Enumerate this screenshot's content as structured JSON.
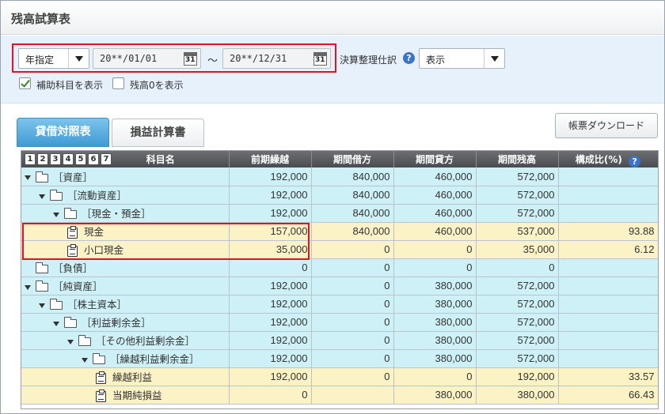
{
  "page": {
    "title": "残高試算表"
  },
  "filter": {
    "period_type": "年指定",
    "date_from": "20**/01/01",
    "date_to": "20**/12/31",
    "range_separator": "〜",
    "calendar_day": "31",
    "closing_entries_label": "決算整理仕訳",
    "closing_entries_value": "表示",
    "show_sub_accounts_label": "補助科目を表示",
    "show_sub_accounts_checked": true,
    "show_zero_balance_label": "残高0を表示",
    "show_zero_balance_checked": false
  },
  "tabs": [
    {
      "label": "貸借対照表",
      "active": true
    },
    {
      "label": "損益計算書",
      "active": false
    }
  ],
  "download_button": "帳票ダウンロード",
  "table": {
    "level_buttons": [
      "1",
      "2",
      "3",
      "4",
      "5",
      "6",
      "7"
    ],
    "columns": [
      "科目名",
      "前期繰越",
      "期間借方",
      "期間貸方",
      "期間残高",
      "構成比(%)"
    ],
    "rows": [
      {
        "name": "［資産］",
        "level": 0,
        "type": "folder",
        "expand": true,
        "color": "blue",
        "values": [
          "192,000",
          "840,000",
          "460,000",
          "572,000",
          ""
        ]
      },
      {
        "name": "［流動資産］",
        "level": 1,
        "type": "folder",
        "expand": true,
        "color": "blue",
        "values": [
          "192,000",
          "840,000",
          "460,000",
          "572,000",
          ""
        ]
      },
      {
        "name": "［現金・預金］",
        "level": 2,
        "type": "folder",
        "expand": true,
        "color": "blue",
        "values": [
          "192,000",
          "840,000",
          "460,000",
          "572,000",
          ""
        ]
      },
      {
        "name": "現金",
        "level": 3,
        "type": "account",
        "expand": false,
        "color": "yellow",
        "values": [
          "157,000",
          "840,000",
          "460,000",
          "537,000",
          "93.88"
        ]
      },
      {
        "name": "小口現金",
        "level": 3,
        "type": "account",
        "expand": false,
        "color": "yellow",
        "values": [
          "35,000",
          "0",
          "0",
          "35,000",
          "6.12"
        ]
      },
      {
        "name": "［負債］",
        "level": 0,
        "type": "folder",
        "expand": false,
        "color": "blue",
        "values": [
          "0",
          "0",
          "0",
          "0",
          ""
        ]
      },
      {
        "name": "［純資産］",
        "level": 0,
        "type": "folder",
        "expand": true,
        "color": "blue",
        "values": [
          "192,000",
          "0",
          "380,000",
          "572,000",
          ""
        ]
      },
      {
        "name": "［株主資本］",
        "level": 1,
        "type": "folder",
        "expand": true,
        "color": "blue",
        "values": [
          "192,000",
          "0",
          "380,000",
          "572,000",
          ""
        ]
      },
      {
        "name": "［利益剰余金］",
        "level": 2,
        "type": "folder",
        "expand": true,
        "color": "blue",
        "values": [
          "192,000",
          "0",
          "380,000",
          "572,000",
          ""
        ]
      },
      {
        "name": "［その他利益剰余金］",
        "level": 3,
        "type": "folder",
        "expand": true,
        "color": "blue",
        "values": [
          "192,000",
          "0",
          "380,000",
          "572,000",
          ""
        ]
      },
      {
        "name": "［繰越利益剰余金］",
        "level": 4,
        "type": "folder",
        "expand": true,
        "color": "blue",
        "values": [
          "192,000",
          "0",
          "380,000",
          "572,000",
          ""
        ]
      },
      {
        "name": "繰越利益",
        "level": 5,
        "type": "account",
        "expand": false,
        "color": "yellow",
        "values": [
          "192,000",
          "0",
          "0",
          "192,000",
          "33.57"
        ]
      },
      {
        "name": "当期純損益",
        "level": 5,
        "type": "account",
        "expand": false,
        "color": "yellow",
        "values": [
          "0",
          "",
          "380,000",
          "380,000",
          "66.43"
        ]
      }
    ]
  },
  "colors": {
    "accent_tab": "#3f9ad3",
    "highlight_border": "#e0141e",
    "row_folder": "#cdf1f7",
    "row_account": "#fbf3c6",
    "header_bg": "#4a4c50"
  }
}
